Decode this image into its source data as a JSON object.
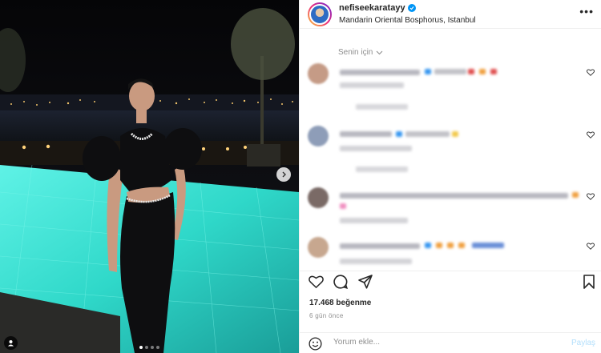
{
  "header": {
    "username": "nefiseekaratayy",
    "location": "Mandarin Oriental Bosphorus, Istanbul",
    "more_icon": "more-horizontal-icon"
  },
  "comments": {
    "sort_label": "Senin için",
    "items": [
      {
        "avatar_color": "#c59b86"
      },
      {
        "avatar_color": "#8e9db8"
      },
      {
        "avatar_color": "#7a6a66"
      },
      {
        "avatar_color": "#c7a78f"
      }
    ]
  },
  "actions": {
    "likes": "17.468 beğenme",
    "time": "6 gün önce"
  },
  "add_comment": {
    "placeholder": "Yorum ekle...",
    "post_label": "Paylaş"
  },
  "carousel": {
    "slide_count": 4,
    "active_slide": 1
  },
  "colors": {
    "accent": "#0095f6",
    "pool": "#3fe3d6",
    "dress": "#0e0e10"
  }
}
